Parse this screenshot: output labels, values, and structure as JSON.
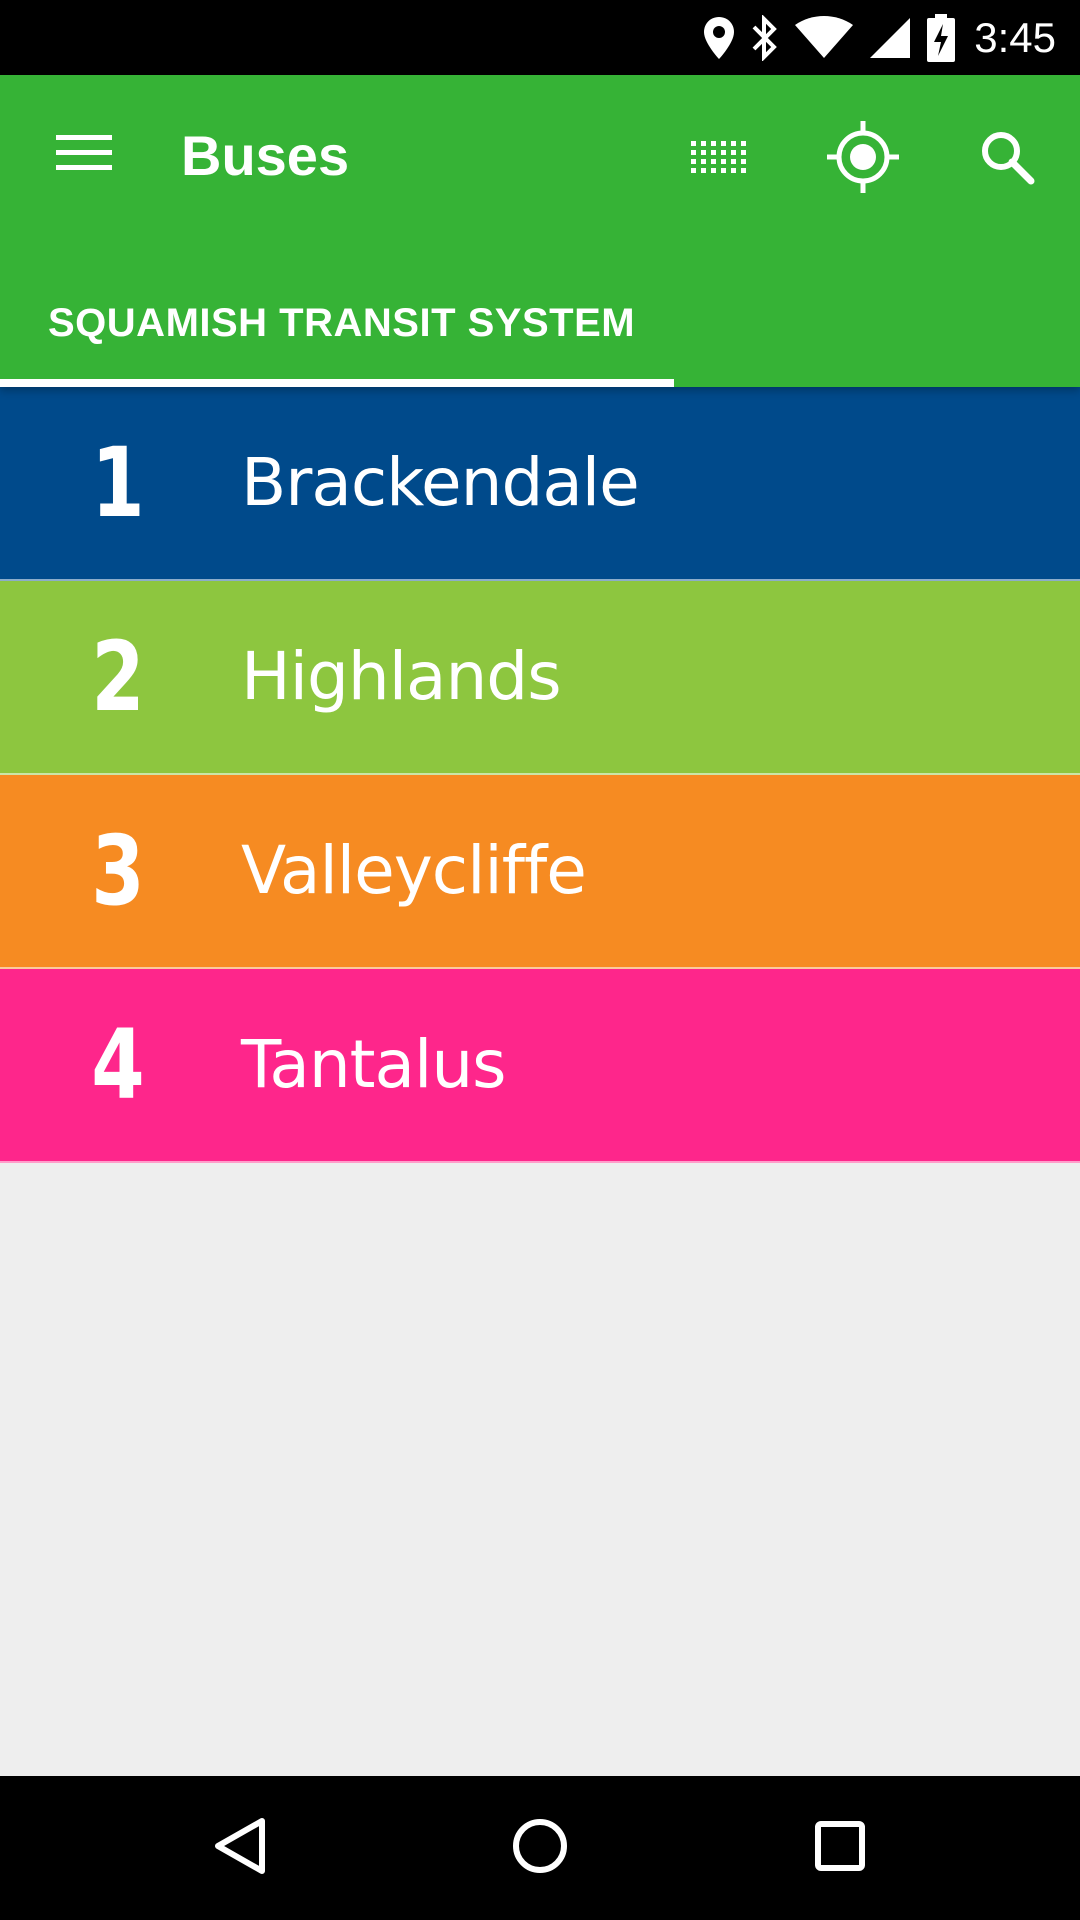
{
  "status_bar": {
    "time": "3:45",
    "icons": [
      "location-pin-icon",
      "bluetooth-icon",
      "wifi-icon",
      "cell-signal-icon",
      "battery-charging-icon"
    ]
  },
  "app_bar": {
    "title": "Buses",
    "background_color": "#36b336",
    "actions": [
      "grid-icon",
      "my-location-icon",
      "search-icon"
    ],
    "menu_icon": "hamburger-menu-icon"
  },
  "tabs": [
    {
      "label": "SQUAMISH TRANSIT SYSTEM",
      "selected": true
    }
  ],
  "routes": [
    {
      "number": "1",
      "name": "Brackendale",
      "color": "#004a8b"
    },
    {
      "number": "2",
      "name": "Highlands",
      "color": "#8dc63f"
    },
    {
      "number": "3",
      "name": "Valleycliffe",
      "color": "#f68b22"
    },
    {
      "number": "4",
      "name": "Tantalus",
      "color": "#fe268b"
    }
  ],
  "nav_bar": {
    "buttons": [
      "back-icon",
      "home-icon",
      "recents-icon"
    ]
  }
}
